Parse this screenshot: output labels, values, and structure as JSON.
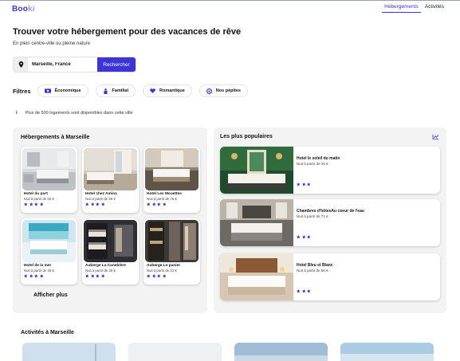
{
  "app": {
    "logo_main": "Boo",
    "logo_accent": "ki",
    "brand_color": "#3b35d8"
  },
  "nav": {
    "items": [
      "Hébergements",
      "Activités"
    ],
    "active": "Hébergements"
  },
  "hero": {
    "title": "Trouver votre hébergement pour des vacances de rêve",
    "subtitle": "En plein centre-ville ou pleine nature"
  },
  "search": {
    "pin_icon": "location-pin-icon",
    "value": "Marseille, France",
    "button": "Rechercher"
  },
  "filters": {
    "title": "Filtres",
    "chips": [
      {
        "label": "Économique",
        "icon": "money-icon"
      },
      {
        "label": "Familial",
        "icon": "family-icon"
      },
      {
        "label": "Romantique",
        "icon": "heart-icon"
      },
      {
        "label": "Nos pépites",
        "icon": "gem-icon"
      }
    ]
  },
  "info": {
    "icon": "info-icon",
    "text": "Plus de 500 logements sont disponibles dans cette ville"
  },
  "lodgings": {
    "title": "Hébergements à Marseille",
    "items": [
      {
        "name": "Hotel du port",
        "price": "Nuit à partir de 52 €",
        "stars": 4
      },
      {
        "name": "Hotel chez Amina",
        "price": "Nuit à partir de 96 €",
        "stars": 4
      },
      {
        "name": "Hotel Les Mouettes",
        "price": "Nuit à partir de 76 €",
        "stars": 4
      },
      {
        "name": "Hotel de la mer",
        "price": "Nuit à partir de 46 €",
        "stars": 4
      },
      {
        "name": "Auberge La Canebière",
        "price": "Nuit à partir de 25 €",
        "stars": 4
      },
      {
        "name": "Auberge Le panier",
        "price": "Nuit à partir de 23 €",
        "stars": 4
      }
    ],
    "more_button": "Afficher plus"
  },
  "popular": {
    "title": "Les plus populaires",
    "icon": "trend-up-icon",
    "items": [
      {
        "name": "Hotel le soleil du matin",
        "price": "Nuit à partir de 25 €",
        "stars": 3
      },
      {
        "name": "Chambres d'hôtesAu coeur de l'eau",
        "price": "Nuit à partir de 71 €",
        "stars": 3
      },
      {
        "name": "Hotel Bleu et Blanc",
        "price": "Nuit à partir de 68 €",
        "stars": 3
      }
    ]
  },
  "activities": {
    "title": "Activités à Marseille"
  },
  "colors": {
    "accent": "#3b35d8",
    "star": "#3b35d8",
    "panel": "#f3f3f3"
  }
}
